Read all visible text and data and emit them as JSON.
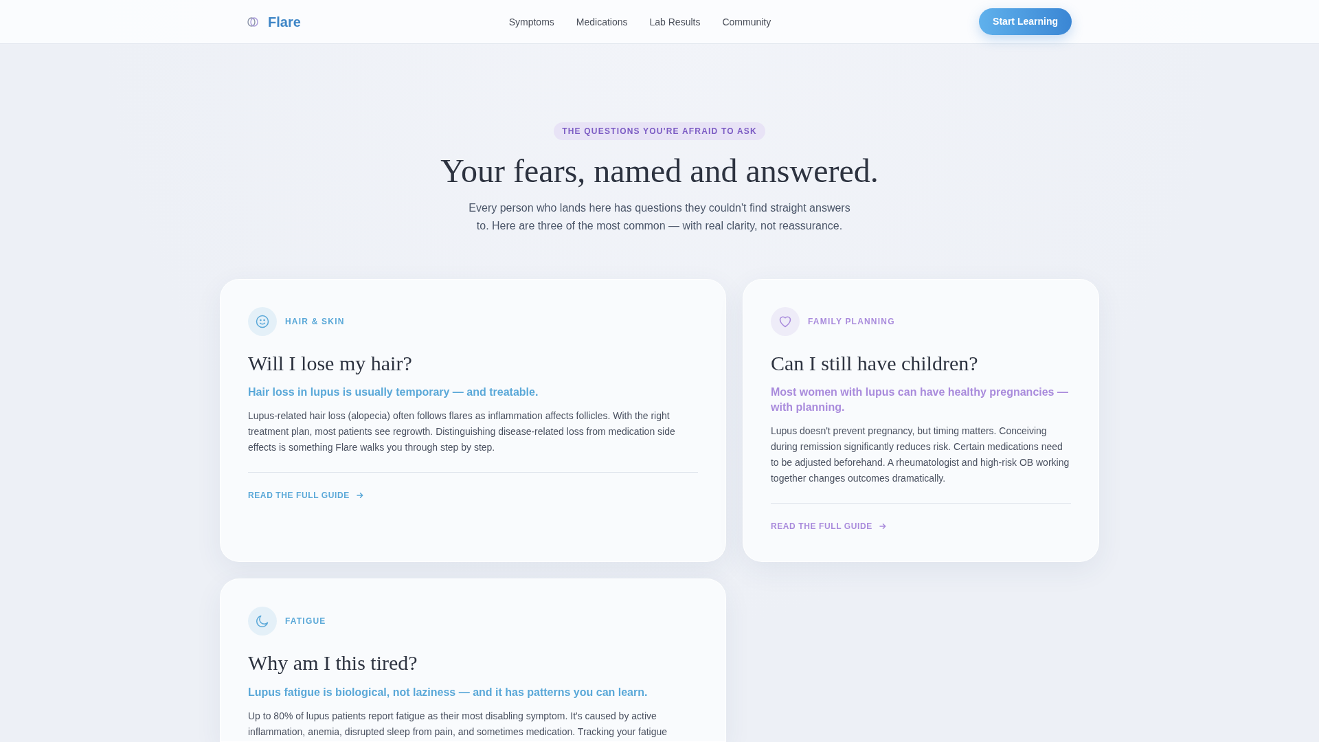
{
  "navbar": {
    "brand": "Flare",
    "links": [
      "Symptoms",
      "Medications",
      "Lab Results",
      "Community"
    ],
    "cta": "Start Learning"
  },
  "hero": {
    "eyebrow": "THE QUESTIONS YOU'RE AFRAID TO ASK",
    "title": "Your fears, named and answered.",
    "intro": "Every person who lands here has questions they couldn't find straight answers to. Here are three of the most common — with real clarity, not reassurance."
  },
  "cards": [
    {
      "kind": "appearance",
      "color": "#5aa8d8",
      "category": "HAIR & SKIN",
      "question": "Will I lose my hair?",
      "answer": "Hair loss in lupus is usually temporary — and treatable.",
      "body": "Lupus-related hair loss (alopecia) often follows flares as inflammation affects follicles. With the right treatment plan, most patients see regrowth. Distinguishing disease-related loss from medication side effects is something Flare walks you through step by step.",
      "link": "READ THE FULL GUIDE"
    },
    {
      "kind": "family",
      "color": "#a98bdc",
      "category": "FAMILY PLANNING",
      "question": "Can I still have children?",
      "answer": "Most women with lupus can have healthy pregnancies — with planning.",
      "body": "Lupus doesn't prevent pregnancy, but timing matters. Conceiving during remission significantly reduces risk. Certain medications need to be adjusted beforehand. A rheumatologist and high-risk OB working together changes outcomes dramatically.",
      "link": "READ THE FULL GUIDE"
    },
    {
      "kind": "energy",
      "color": "#5aa8d8",
      "category": "FATIGUE",
      "question": "Why am I this tired?",
      "answer": "Lupus fatigue is biological, not laziness — and it has patterns you can learn.",
      "body": "Up to 80% of lupus patients report fatigue as their most disabling symptom. It's caused by active inflammation, anemia, disrupted sleep from pain, and sometimes medication. Tracking your fatigue"
    }
  ]
}
